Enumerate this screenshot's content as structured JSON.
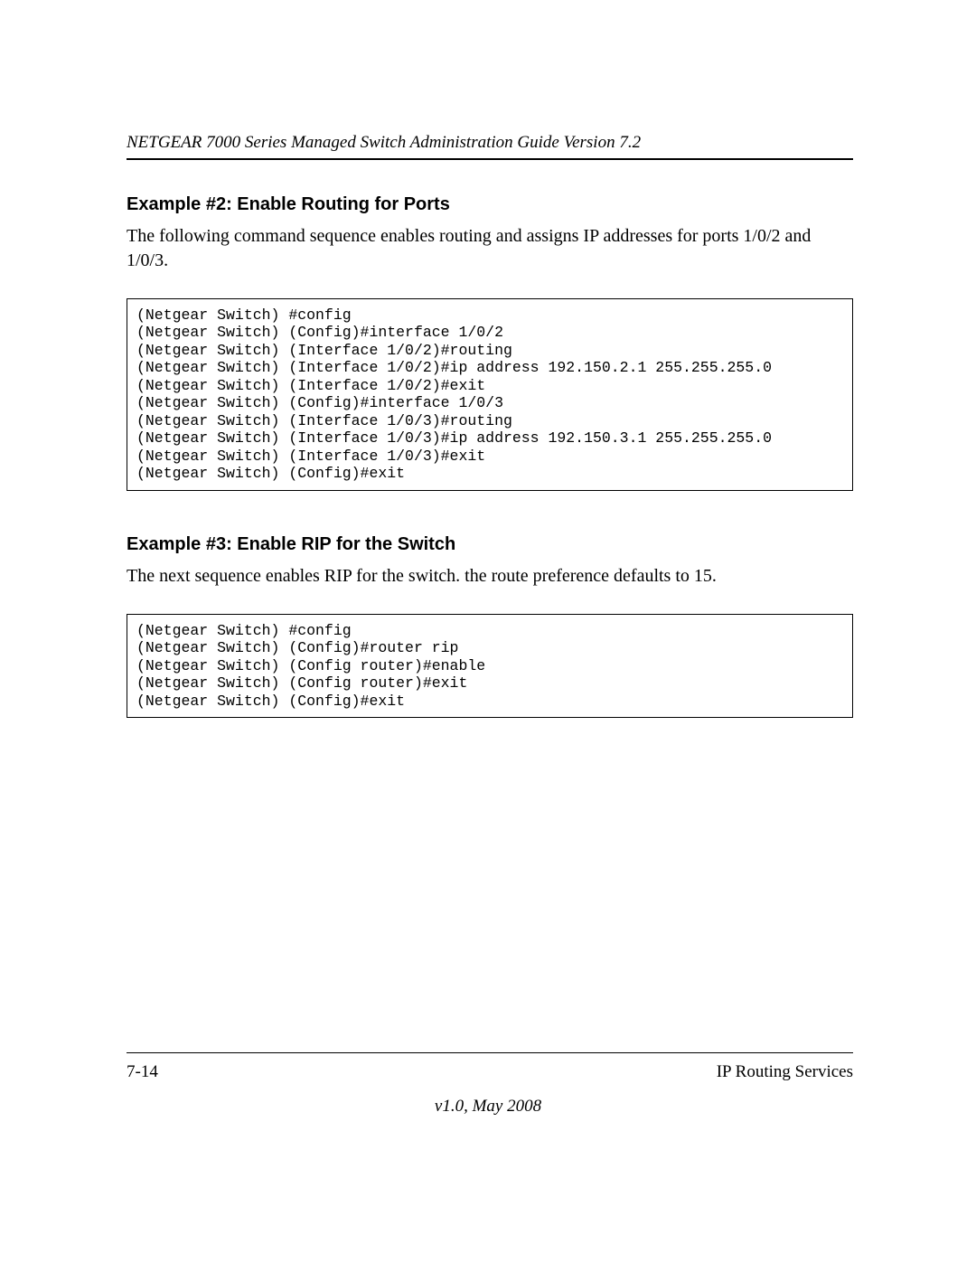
{
  "header": {
    "running": "NETGEAR 7000 Series Managed Switch Administration Guide Version 7.2"
  },
  "sections": [
    {
      "heading": "Example #2: Enable Routing for Ports",
      "para": "The following command sequence enables routing and assigns IP addresses for ports 1/0/2 and 1/0/3.",
      "code": "(Netgear Switch) #config\n(Netgear Switch) (Config)#interface 1/0/2\n(Netgear Switch) (Interface 1/0/2)#routing\n(Netgear Switch) (Interface 1/0/2)#ip address 192.150.2.1 255.255.255.0\n(Netgear Switch) (Interface 1/0/2)#exit\n(Netgear Switch) (Config)#interface 1/0/3\n(Netgear Switch) (Interface 1/0/3)#routing\n(Netgear Switch) (Interface 1/0/3)#ip address 192.150.3.1 255.255.255.0\n(Netgear Switch) (Interface 1/0/3)#exit\n(Netgear Switch) (Config)#exit"
    },
    {
      "heading": "Example #3: Enable RIP for the Switch",
      "para": "The next sequence enables RIP for the switch. the route preference defaults to 15.",
      "code": "(Netgear Switch) #config\n(Netgear Switch) (Config)#router rip\n(Netgear Switch) (Config router)#enable\n(Netgear Switch) (Config router)#exit\n(Netgear Switch) (Config)#exit"
    }
  ],
  "footer": {
    "page_number": "7-14",
    "section_title": "IP Routing Services",
    "version_line": "v1.0, May 2008"
  }
}
